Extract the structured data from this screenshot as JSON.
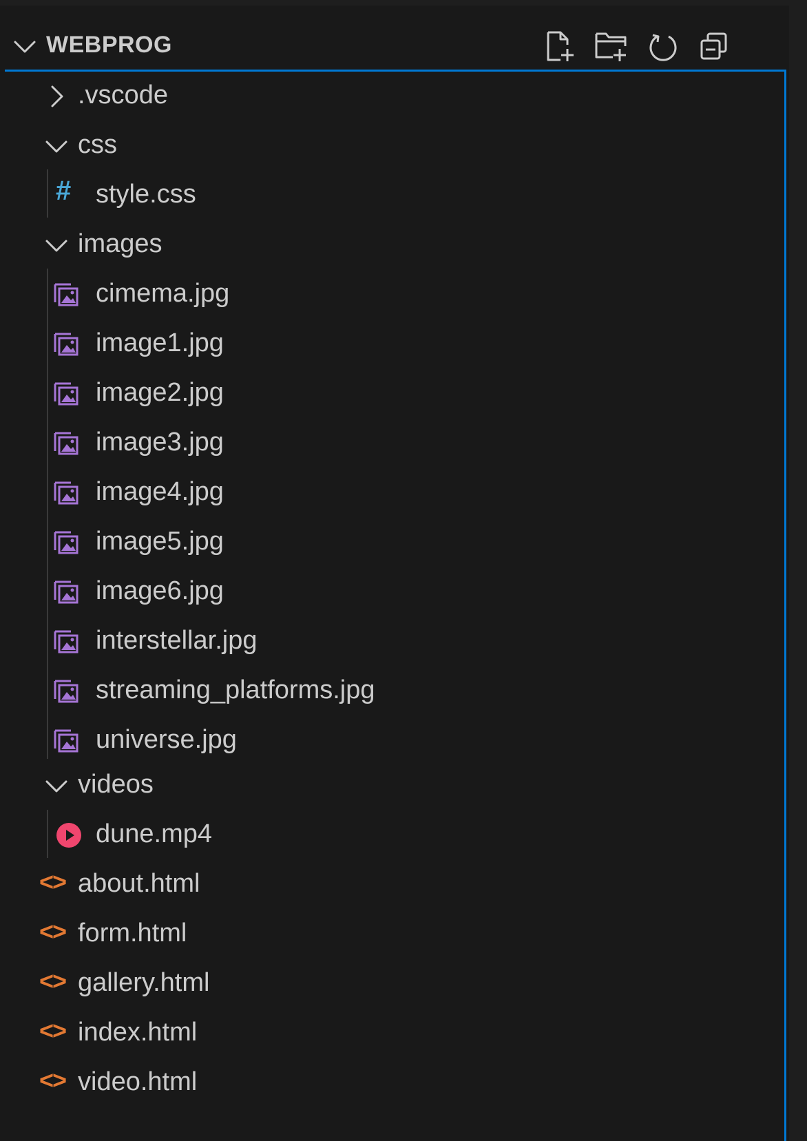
{
  "explorer": {
    "section_title": "WEBPROG",
    "actions": [
      {
        "name": "new-file",
        "icon": "new-file-icon"
      },
      {
        "name": "new-folder",
        "icon": "new-folder-icon"
      },
      {
        "name": "refresh",
        "icon": "refresh-icon"
      },
      {
        "name": "collapse-all",
        "icon": "collapse-all-icon"
      }
    ],
    "colors": {
      "background": "#191919",
      "text": "#cccccc",
      "focus_border": "#0078d4",
      "css_icon": "#4aa8d8",
      "image_icon": "#a675d6",
      "video_icon": "#f0466e",
      "html_icon": "#e37933"
    },
    "tree": {
      "vscode": {
        "label": ".vscode",
        "state": "collapsed"
      },
      "css": {
        "label": "css",
        "state": "expanded"
      },
      "style_css": {
        "label": "style.css",
        "icon": "css-hash-icon",
        "icon_glyph": "#"
      },
      "images": {
        "label": "images",
        "state": "expanded"
      },
      "image_files": [
        {
          "label": "cimema.jpg"
        },
        {
          "label": "image1.jpg"
        },
        {
          "label": "image2.jpg"
        },
        {
          "label": "image3.jpg"
        },
        {
          "label": "image4.jpg"
        },
        {
          "label": "image5.jpg"
        },
        {
          "label": "image6.jpg"
        },
        {
          "label": "interstellar.jpg"
        },
        {
          "label": "streaming_platforms.jpg"
        },
        {
          "label": "universe.jpg"
        }
      ],
      "videos": {
        "label": "videos",
        "state": "expanded"
      },
      "dune": {
        "label": "dune.mp4",
        "icon": "video-play-icon"
      },
      "html_files": [
        {
          "label": "about.html"
        },
        {
          "label": "form.html"
        },
        {
          "label": "gallery.html"
        },
        {
          "label": "index.html"
        },
        {
          "label": "video.html"
        }
      ],
      "html_icon_glyph": "<>"
    }
  }
}
